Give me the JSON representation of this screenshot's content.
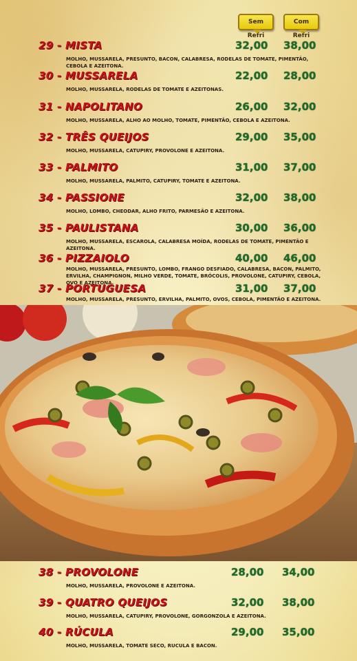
{
  "headers": {
    "sem_refri": "Sem Refri",
    "com_refri": "Com Refri"
  },
  "items": [
    {
      "name": "29 - MISTA",
      "sem": "32,00",
      "com": "38,00",
      "desc": "MOLHO, MUSSARELA, PRESUNTO, BACON, CALABRESA, RODELAS DE TOMATE, PIMENTÃO, CEBOLA E AZEITONA."
    },
    {
      "name": "30 - MUSSARELA",
      "sem": "22,00",
      "com": "28,00",
      "desc": "MOLHO, MUSSARELA, RODELAS DE TOMATE E AZEITONAS."
    },
    {
      "name": "31 - NAPOLITANO",
      "sem": "26,00",
      "com": "32,00",
      "desc": "MOLHO, MUSSARELA, ALHO AO MOLHO, TOMATE, PIMENTÃO, CEBOLA E AZEITONA."
    },
    {
      "name": "32 - TRÊS QUEIJOS",
      "sem": "29,00",
      "com": "35,00",
      "desc": "MOLHO, MUSSARELA, CATUPIRY, PROVOLONE E AZEITONA."
    },
    {
      "name": "33 - PALMITO",
      "sem": "31,00",
      "com": "37,00",
      "desc": "MOLHO, MUSSARELA, PALMITO, CATUPIRY, TOMATE E AZEITONA."
    },
    {
      "name": "34 - PASSIONE",
      "sem": "32,00",
      "com": "38,00",
      "desc": "MOLHO, LOMBO, CHEODAR, ALHO FRITO, PARMESÃO E AZEITONA."
    },
    {
      "name": "35 - PAULISTANA",
      "sem": "30,00",
      "com": "36,00",
      "desc": "MOLHO, MUSSARELA, ESCAROLA, CALABRESA MOÍDA, RODELAS DE TOMATE, PIMENTÃO E AZEITONA."
    },
    {
      "name": "36 - PIZZAIOLO",
      "sem": "40,00",
      "com": "46,00",
      "desc": "MOLHO, MUSSARELA, PRESUNTO, LOMBO, FRANGO DESFIADO, CALABRESA, BACON, PALMITO, ERVILHA, CHAMPIGNON, MILHO VERDE, TOMATE, BRÓCOLIS, PROVOLONE, CATUPIRY, CEBOLA, OVO E AZEITONA."
    },
    {
      "name": "37 - PORTUGUESA",
      "sem": "31,00",
      "com": "37,00",
      "desc": "MOLHO, MUSSARELA, PRESUNTO, ERVILHA, PALMITO, OVOS, CEBOLA, PIMENTÃO E AZEITONA."
    },
    {
      "name": "38 - PROVOLONE",
      "sem": "28,00",
      "com": "34,00",
      "desc": "MOLHO, MUSSARELA, PROVOLONE E AZEITONA."
    },
    {
      "name": "39 - QUATRO QUEIJOS",
      "sem": "32,00",
      "com": "38,00",
      "desc": "MOLHO, MUSSARELA, CATUPIRY, PROVOLONE, GORGONZOLA E AZEITONA."
    },
    {
      "name": "40 - RÚCULA",
      "sem": "29,00",
      "com": "35,00",
      "desc": "MOLHO, MUSSARELA, TOMATE SECO, RUCULA E BACON."
    }
  ],
  "colors": {
    "item_name": "#c4141b",
    "price": "#1f6a2a",
    "badge": "#f0d52a",
    "paper": "#f5eebb"
  },
  "image": {
    "name": "pizza-photo"
  }
}
